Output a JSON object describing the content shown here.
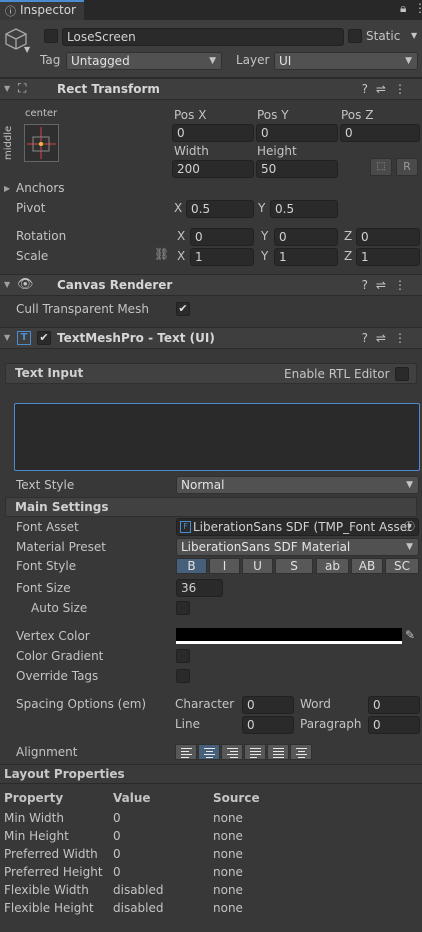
{
  "tab": {
    "label": "Inspector"
  },
  "object": {
    "name": "LoseScreen",
    "static_label": "Static",
    "tag_label": "Tag",
    "tag_value": "Untagged",
    "layer_label": "Layer",
    "layer_value": "UI"
  },
  "rect_transform": {
    "title": "Rect Transform",
    "anchor_h": "center",
    "anchor_v": "middle",
    "pos_x_label": "Pos X",
    "pos_y_label": "Pos Y",
    "pos_z_label": "Pos Z",
    "pos_x": "0",
    "pos_y": "0",
    "pos_z": "0",
    "width_label": "Width",
    "height_label": "Height",
    "width": "200",
    "height": "50",
    "r_label": "R",
    "anchors_label": "Anchors",
    "pivot_label": "Pivot",
    "pivot_x": "0.5",
    "pivot_y": "0.5",
    "rotation_label": "Rotation",
    "rot_x": "0",
    "rot_y": "0",
    "rot_z": "0",
    "scale_label": "Scale",
    "scale_x": "1",
    "scale_y": "1",
    "scale_z": "1",
    "x": "X",
    "y": "Y",
    "z": "Z"
  },
  "canvas_renderer": {
    "title": "Canvas Renderer",
    "cull_label": "Cull Transparent Mesh",
    "cull_checked": true
  },
  "tmp": {
    "title": "TextMeshPro - Text (UI)",
    "text_input_label": "Text Input",
    "rtl_label": "Enable RTL Editor",
    "text_value": "",
    "text_style_label": "Text Style",
    "text_style_value": "Normal",
    "main_settings_label": "Main Settings",
    "font_asset_label": "Font Asset",
    "font_asset_value": "LiberationSans SDF (TMP_Font Asset",
    "material_preset_label": "Material Preset",
    "material_preset_value": "LiberationSans SDF Material",
    "font_style_label": "Font Style",
    "font_styles": [
      "B",
      "I",
      "U",
      "S",
      "ab",
      "AB",
      "SC"
    ],
    "font_size_label": "Font Size",
    "font_size_value": "36",
    "auto_size_label": "Auto Size",
    "vertex_color_label": "Vertex Color",
    "vertex_color": "#000000",
    "color_gradient_label": "Color Gradient",
    "override_tags_label": "Override Tags",
    "spacing_label": "Spacing Options (em)",
    "character_label": "Character",
    "character_value": "0",
    "word_label": "Word",
    "word_value": "0",
    "line_label": "Line",
    "line_value": "0",
    "paragraph_label": "Paragraph",
    "paragraph_value": "0",
    "alignment_label": "Alignment",
    "alignment_options": [
      "left",
      "center",
      "right",
      "justified",
      "flush",
      "geometry-center"
    ],
    "alignment_selected": "center"
  },
  "layout_properties": {
    "title": "Layout Properties",
    "columns": [
      "Property",
      "Value",
      "Source"
    ],
    "rows": [
      [
        "Min Width",
        "0",
        "none"
      ],
      [
        "Min Height",
        "0",
        "none"
      ],
      [
        "Preferred Width",
        "0",
        "none"
      ],
      [
        "Preferred Height",
        "0",
        "none"
      ],
      [
        "Flexible Width",
        "disabled",
        "none"
      ],
      [
        "Flexible Height",
        "disabled",
        "none"
      ]
    ]
  },
  "colors": {
    "accent_focus": "#4d8bd1",
    "selected_button": "#46607c",
    "anchor_red": "#d94040",
    "anchor_yellow": "#f0c040"
  }
}
